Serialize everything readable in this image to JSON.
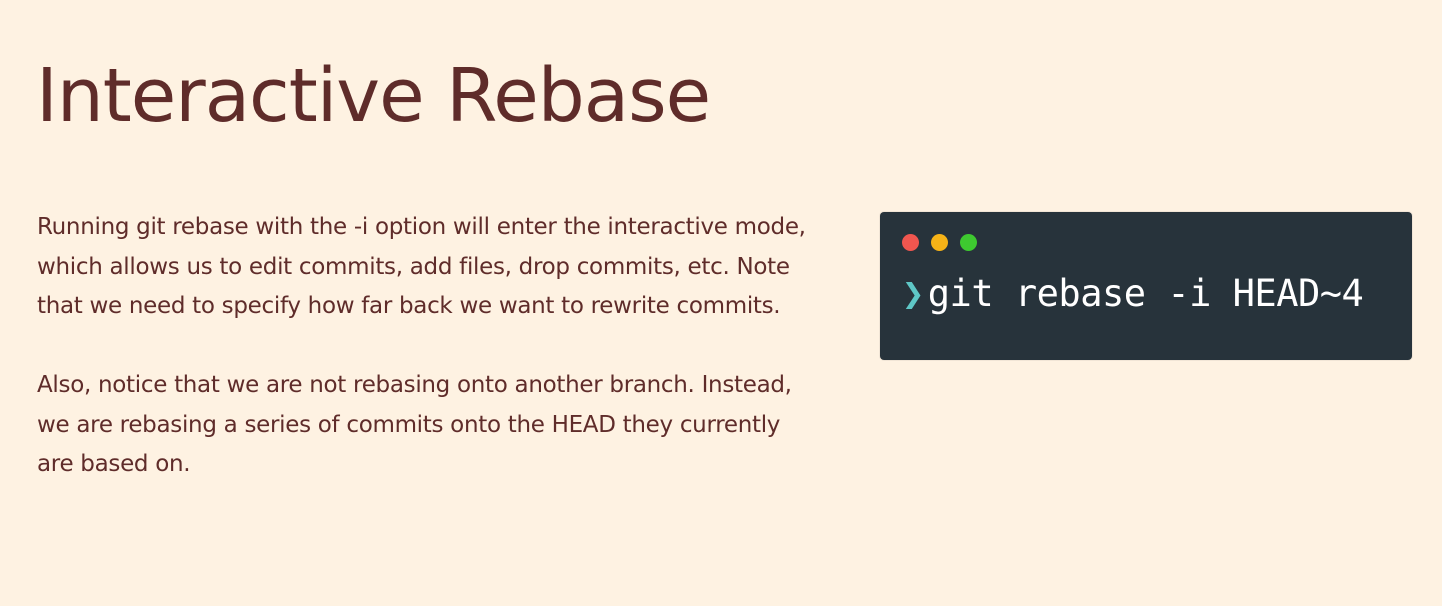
{
  "slide": {
    "title": "Interactive Rebase",
    "paragraphs": [
      "Running git rebase with the -i option will enter the interactive mode, which allows us to edit commits, add files, drop commits, etc.  Note that we need to specify how far back we want to rewrite commits.",
      "Also, notice that we are not rebasing onto another branch. Instead, we are rebasing a series of commits onto the HEAD they currently are based on."
    ]
  },
  "terminal": {
    "prompt_symbol": "❯",
    "command": "git rebase -i HEAD~4",
    "window_buttons": [
      {
        "name": "close",
        "color": "#f0564f"
      },
      {
        "name": "minimize",
        "color": "#f6b317"
      },
      {
        "name": "maximize",
        "color": "#3ec930"
      }
    ]
  },
  "colors": {
    "background": "#fef2e2",
    "text": "#5f2c2a",
    "terminal_bg": "#27333b",
    "prompt": "#5ec7c6",
    "command_text": "#ffffff"
  }
}
